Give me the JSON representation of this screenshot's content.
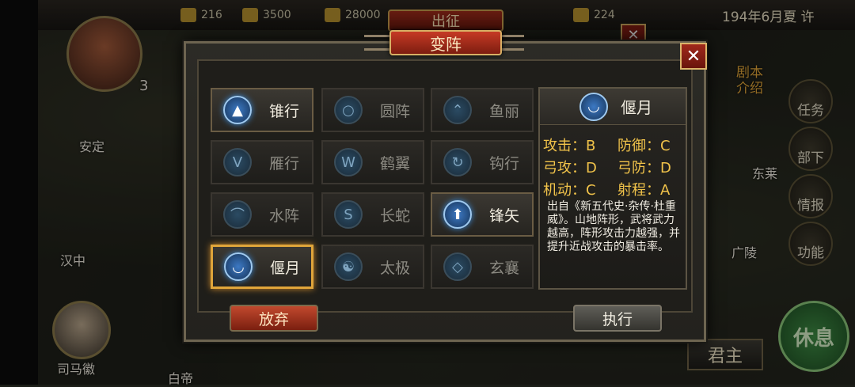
{
  "topbar": {
    "resources": [
      "216",
      "3500",
      "28000",
      "224"
    ],
    "date": "194年6月夏 许"
  },
  "map": {
    "labels": [
      "安定",
      "汉中",
      "东莱",
      "广陵",
      "司马徽",
      "白帝"
    ],
    "right_buttons": [
      "任务",
      "部下",
      "情报",
      "功能"
    ],
    "script_intro": "剧本介绍",
    "bottom_buttons": [
      "君主",
      "休息"
    ],
    "badge_number": "3"
  },
  "back_dialog": {
    "title": "出征"
  },
  "dialog": {
    "title": "变阵",
    "close": "✕",
    "formations": [
      {
        "label": "锥行",
        "icon": "arrow-up-icon",
        "glyph": "▲",
        "active": true,
        "selected": false
      },
      {
        "label": "圆阵",
        "icon": "circle-icon",
        "glyph": "○",
        "active": false,
        "selected": false
      },
      {
        "label": "鱼丽",
        "icon": "fish-scale-icon",
        "glyph": "⌃",
        "active": false,
        "selected": false
      },
      {
        "label": "雁行",
        "icon": "v-shape-icon",
        "glyph": "V",
        "active": false,
        "selected": false
      },
      {
        "label": "鹤翼",
        "icon": "w-shape-icon",
        "glyph": "W",
        "active": false,
        "selected": false
      },
      {
        "label": "钩行",
        "icon": "hook-icon",
        "glyph": "↻",
        "active": false,
        "selected": false
      },
      {
        "label": "水阵",
        "icon": "water-icon",
        "glyph": "⌒",
        "active": false,
        "selected": false
      },
      {
        "label": "长蛇",
        "icon": "snake-icon",
        "glyph": "S",
        "active": false,
        "selected": false
      },
      {
        "label": "锋矢",
        "icon": "arrow-up-icon",
        "glyph": "⬆",
        "active": true,
        "selected": false
      },
      {
        "label": "偃月",
        "icon": "crescent-icon",
        "glyph": "◡",
        "active": true,
        "selected": true
      },
      {
        "label": "太极",
        "icon": "taiji-icon",
        "glyph": "☯",
        "active": false,
        "selected": false
      },
      {
        "label": "玄襄",
        "icon": "diamond-icon",
        "glyph": "◇",
        "active": false,
        "selected": false
      }
    ],
    "info": {
      "name": "偃月",
      "stats": [
        {
          "label": "攻击",
          "value": "B"
        },
        {
          "label": "防御",
          "value": "C"
        },
        {
          "label": "弓攻",
          "value": "D"
        },
        {
          "label": "弓防",
          "value": "D"
        },
        {
          "label": "机动",
          "value": "C"
        },
        {
          "label": "射程",
          "value": "A"
        }
      ],
      "description": "出自《新五代史·杂传·杜重威》。山地阵形，武将武力越高，阵形攻击力越强，并提升近战攻击的暴击率。"
    },
    "abandon_label": "放弃",
    "execute_label": "执行"
  }
}
